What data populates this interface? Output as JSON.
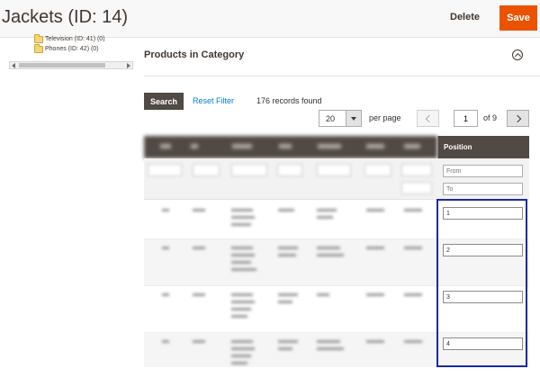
{
  "header": {
    "title": "Jackets (ID: 14)",
    "delete_label": "Delete",
    "save_label": "Save"
  },
  "tree": {
    "items": [
      {
        "label": "Television (ID: 41) (0)",
        "icon": "folder-icon"
      },
      {
        "label": "Phones (ID: 42) (0)",
        "icon": "folder-icon"
      }
    ]
  },
  "section": {
    "title": "Products in Category"
  },
  "toolbar": {
    "search_label": "Search",
    "reset_label": "Reset Filter",
    "records_text": "176 records found",
    "per_page_value": "20",
    "per_page_label": "per page",
    "current_page": "1",
    "of_pages": "of 9"
  },
  "grid": {
    "position_header": "Position",
    "position_filter_from_placeholder": "From",
    "position_filter_to_placeholder": "To",
    "rows": [
      {
        "position": "1"
      },
      {
        "position": "2"
      },
      {
        "position": "3"
      },
      {
        "position": "4"
      }
    ]
  },
  "colors": {
    "accent": "#eb5202",
    "grid_header": "#514943",
    "link": "#007bdb",
    "highlight": "#1a2aa0"
  }
}
